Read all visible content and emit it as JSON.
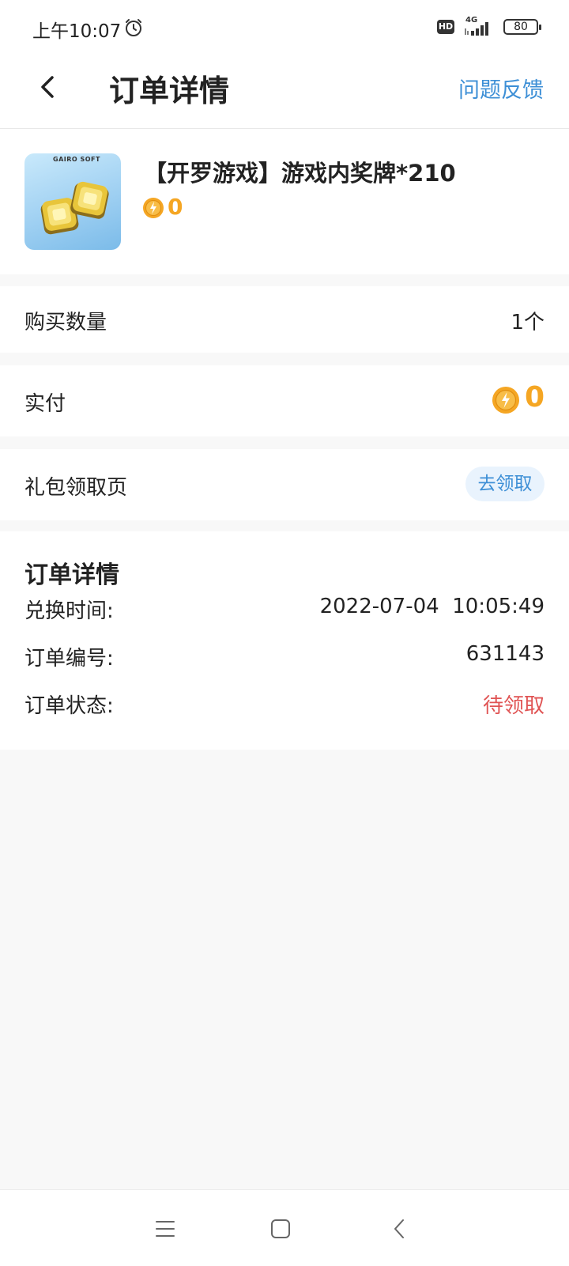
{
  "status_bar": {
    "time": "上午10:07",
    "hd_label": "HD",
    "network": "4G",
    "battery": "80",
    "icons": [
      "alarm-icon",
      "signal-icon",
      "battery-icon"
    ]
  },
  "header": {
    "title": "订单详情",
    "feedback_label": "问题反馈",
    "back_icon": "chevron-left-icon"
  },
  "product": {
    "thumb_text": "GAIRO SOFT",
    "name": "【开罗游戏】游戏内奖牌*210",
    "price": "0",
    "price_icon": "coin-icon"
  },
  "purchase_quantity": {
    "label": "购买数量",
    "value": "1个"
  },
  "payment": {
    "label": "实付",
    "value": "0",
    "icon": "coin-icon"
  },
  "gift": {
    "label": "礼包领取页",
    "button_label": "去领取"
  },
  "order_details": {
    "title": "订单详情",
    "rows": [
      {
        "label": "兑换时间:",
        "value": "2022-07-04  10:05:49"
      },
      {
        "label": "订单编号:",
        "value": "631143"
      },
      {
        "label": "订单状态:",
        "value": "待领取"
      }
    ]
  },
  "colors": {
    "accent_blue": "#3d8fd6",
    "coin_orange": "#f5a623",
    "status_red": "#e05454",
    "page_bg": "#f8f8f8"
  },
  "nav_bar": {
    "icons": [
      "menu-icon",
      "home-icon",
      "back-icon"
    ]
  }
}
